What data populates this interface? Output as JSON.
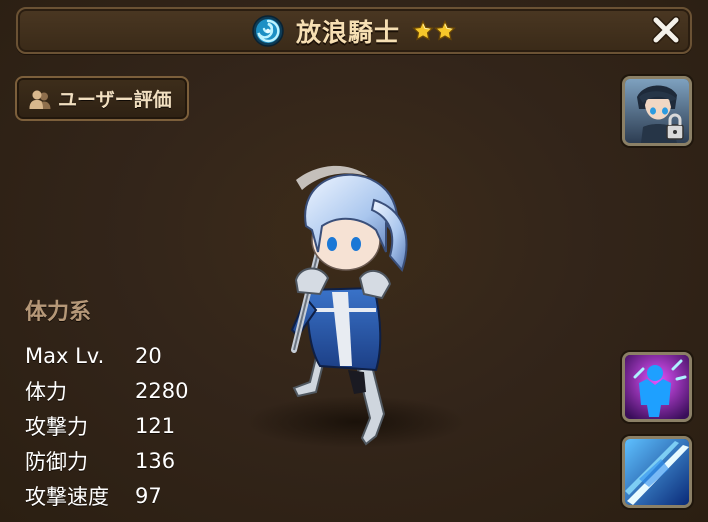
{
  "header": {
    "title": "放浪騎士",
    "element_icon": "water-element-icon",
    "star_count": 2,
    "star_icon": "star-icon",
    "close_icon": "close-icon"
  },
  "rating_button": {
    "label": "ユーザー評価",
    "icon": "people-icon"
  },
  "portrait": {
    "icon": "character-portrait-icon",
    "lock_icon": "lock-icon"
  },
  "skills": [
    {
      "icon": "skill-buff-icon"
    },
    {
      "icon": "skill-slash-icon"
    }
  ],
  "stats": {
    "category": "体力系",
    "rows": [
      {
        "label": "Max Lv.",
        "value": "20"
      },
      {
        "label": "体力",
        "value": "2280"
      },
      {
        "label": "攻撃力",
        "value": "121"
      },
      {
        "label": "防御力",
        "value": "136"
      },
      {
        "label": "攻撃速度",
        "value": "97"
      }
    ]
  },
  "colors": {
    "background": "#33251a",
    "title_text": "#f6dfb3",
    "category_text": "#b69878",
    "star": "#f5c62a",
    "water_element": "#2fb7e8"
  }
}
